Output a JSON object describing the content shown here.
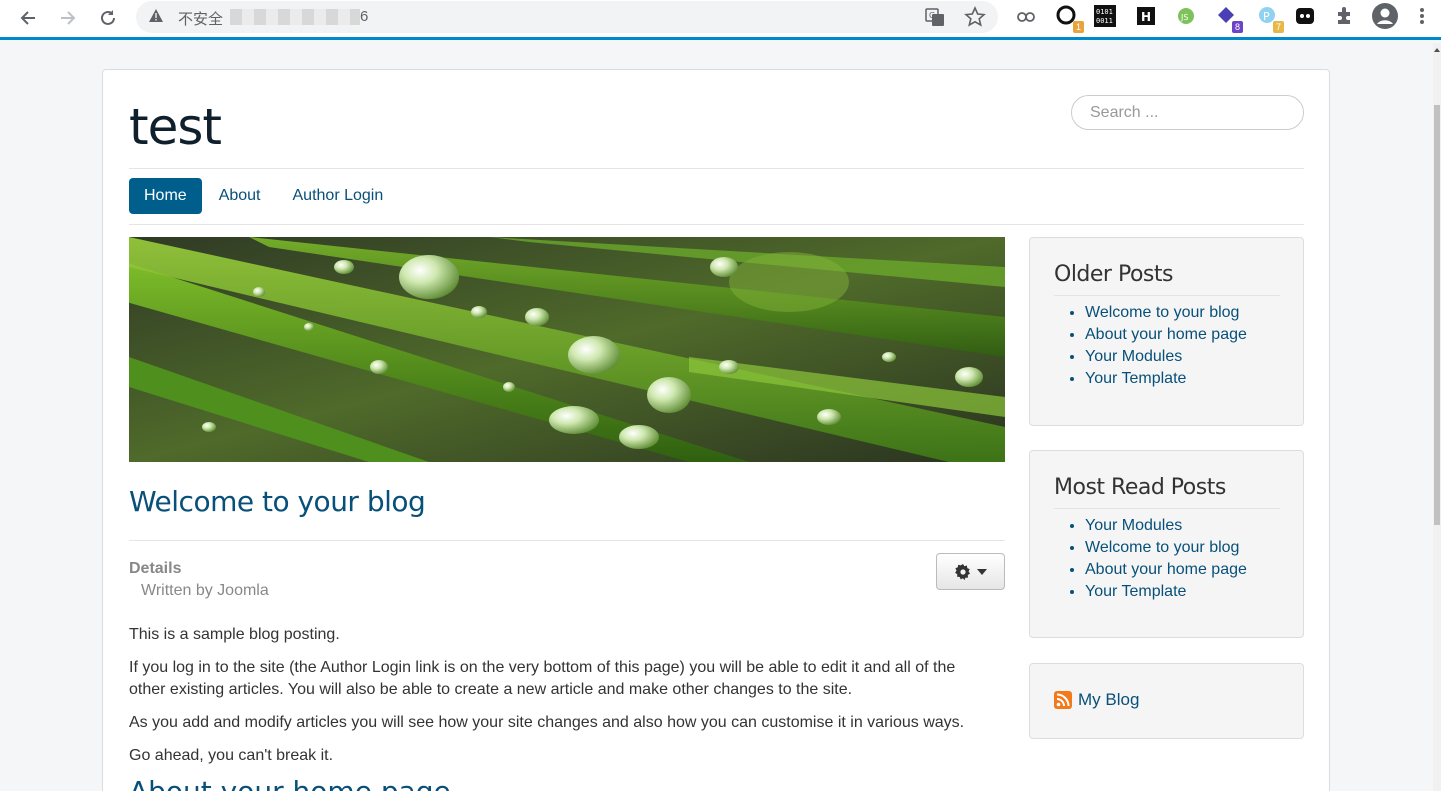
{
  "browser": {
    "security_label": "不安全",
    "url_tail": "6"
  },
  "site": {
    "brand": "test",
    "search_placeholder": "Search ...",
    "menu": [
      {
        "label": "Home",
        "active": true
      },
      {
        "label": "About",
        "active": false
      },
      {
        "label": "Author Login",
        "active": false
      }
    ]
  },
  "article": {
    "title": "Welcome to your blog",
    "details_label": "Details",
    "written_by": "Written by Joomla",
    "paragraphs": [
      "This is a sample blog posting.",
      "If you log in to the site (the Author Login link is on the very bottom of this page) you will be able to edit it and all of the other existing articles. You will also be able to create a new article and make other changes to the site.",
      "As you add and modify articles you will see how your site changes and also how you can customise it in various ways.",
      "Go ahead, you can't break it."
    ],
    "next_title": "About your home page"
  },
  "sidebar": {
    "older_posts": {
      "title": "Older Posts",
      "items": [
        "Welcome to your blog",
        "About your home page",
        "Your Modules",
        "Your Template"
      ]
    },
    "most_read": {
      "title": "Most Read Posts",
      "items": [
        "Your Modules",
        "Welcome to your blog",
        "About your home page",
        "Your Template"
      ]
    },
    "feed": {
      "label": "My Blog"
    }
  },
  "colors": {
    "accent": "#005e8d",
    "link": "#08507a",
    "chrome_accent": "#0088cc"
  }
}
